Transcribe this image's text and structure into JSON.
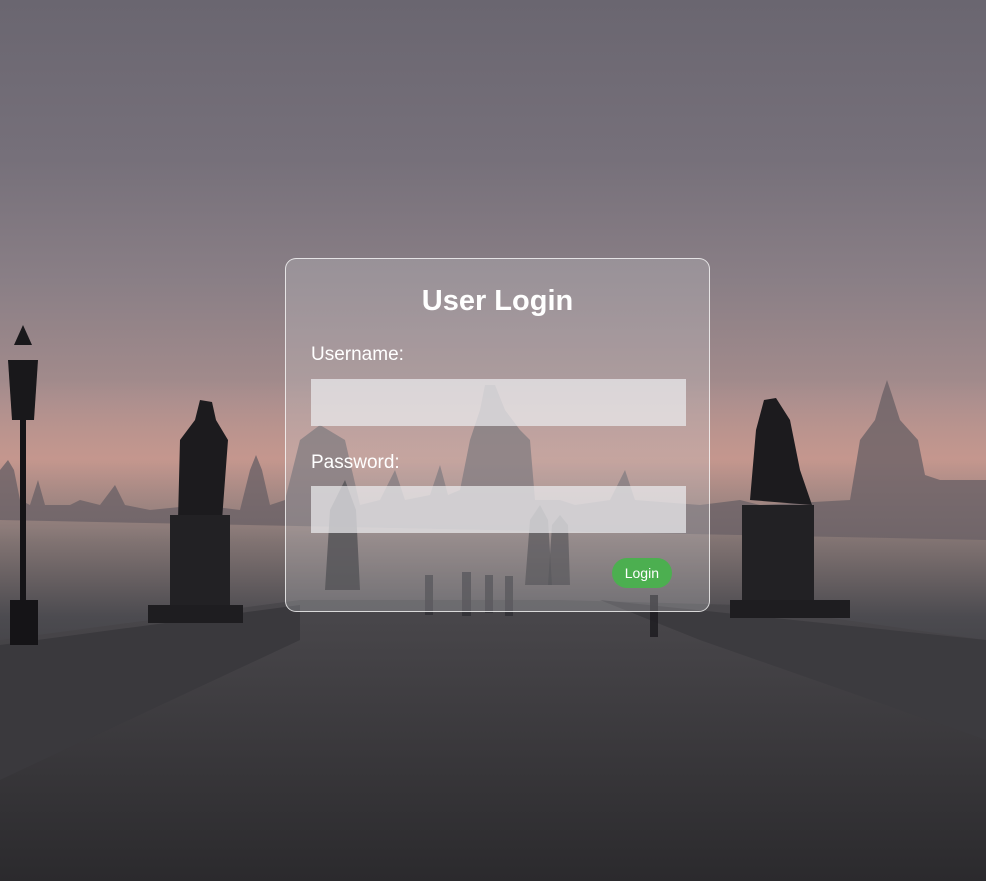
{
  "background": {
    "description_icon": "bridge-photo-background"
  },
  "login_form": {
    "title": "User Login",
    "username_label": "Username:",
    "username_value": "",
    "password_label": "Password:",
    "password_value": "",
    "submit_label": "Login"
  },
  "colors": {
    "button": "#4caf50",
    "text": "#ffffff"
  }
}
